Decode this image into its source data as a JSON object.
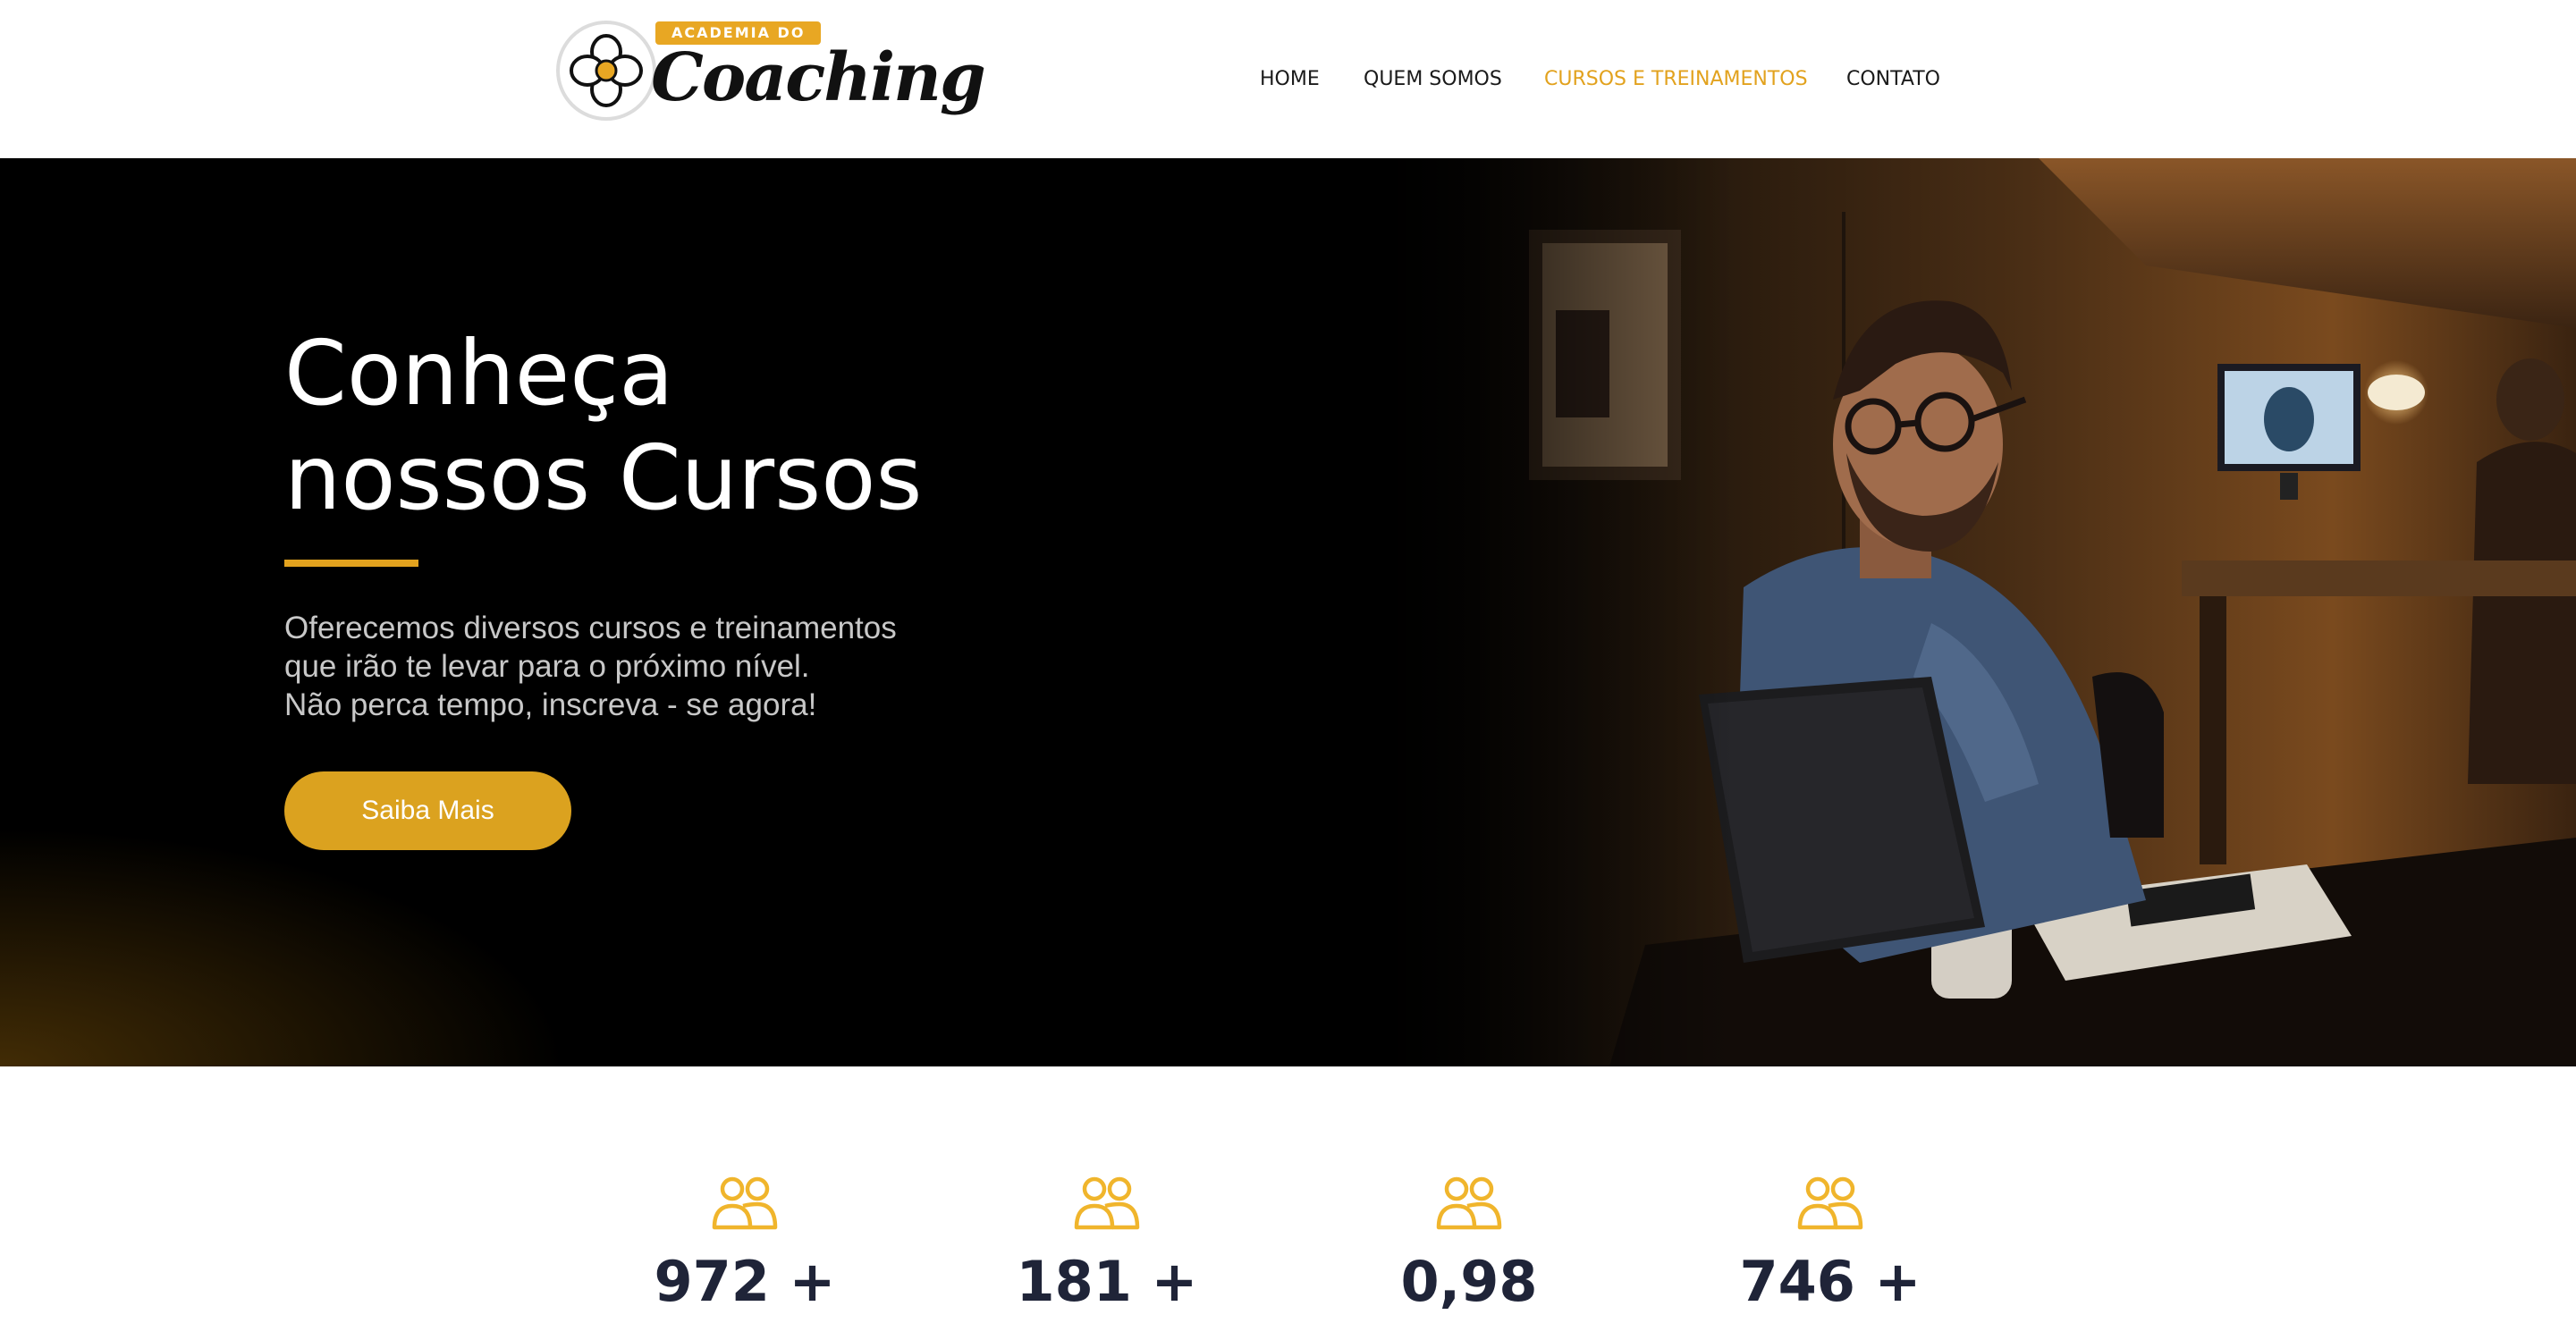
{
  "brand": {
    "ribbon_text": "ACADEMIA DO",
    "script_text": "Coaching",
    "logo_icon": "flower-emblem-icon",
    "accent_color": "#e2a21e"
  },
  "nav": {
    "items": [
      {
        "label": "HOME",
        "active": false
      },
      {
        "label": "QUEM SOMOS",
        "active": false
      },
      {
        "label": "CURSOS E TREINAMENTOS",
        "active": true
      },
      {
        "label": "CONTATO",
        "active": false
      }
    ]
  },
  "hero": {
    "title_line1": "Conheça",
    "title_line2": "nossos Cursos",
    "text_line1": "Oferecemos diversos cursos e treinamentos",
    "text_line2": "que irão te levar para o próximo nível.",
    "text_line3": "Não perca tempo, inscreva - se agora!",
    "button_label": "Saiba Mais",
    "button_color": "#dba21f"
  },
  "stats": {
    "icon": "users-icon",
    "items": [
      {
        "value": "972 +"
      },
      {
        "value": "181 +"
      },
      {
        "value": "0,98"
      },
      {
        "value": "746 +"
      }
    ]
  }
}
